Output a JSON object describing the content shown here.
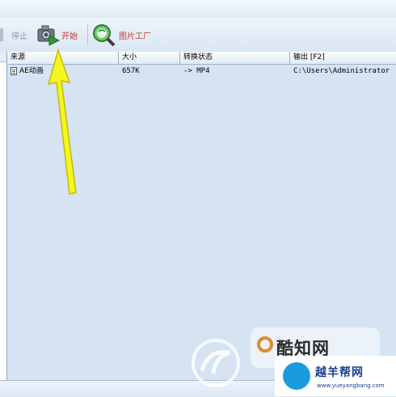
{
  "toolbar": {
    "stop_label": "停止",
    "start_label": "开始",
    "image_factory_label": "图片工厂",
    "icons": {
      "stop": "stop-icon",
      "start": "camera-play-icon",
      "image_factory": "magnifier-globe-icon"
    }
  },
  "list": {
    "columns": {
      "source": "来源",
      "size": "大小",
      "status": "转换状态",
      "output": "输出 [F2]"
    },
    "rows": [
      {
        "source": "AE动画",
        "size": "657K",
        "status": "-> MP4",
        "output": "C:\\Users\\Administrator"
      }
    ]
  },
  "watermarks": {
    "kuzhiwang": "酷知网",
    "yueyang_name": "越羊帮网",
    "yueyang_url": "www.yueyangbang.com"
  },
  "colors": {
    "arrow": "#f2f71e",
    "start_label": "#c0392b",
    "window_bg": "#d5e3f2"
  }
}
